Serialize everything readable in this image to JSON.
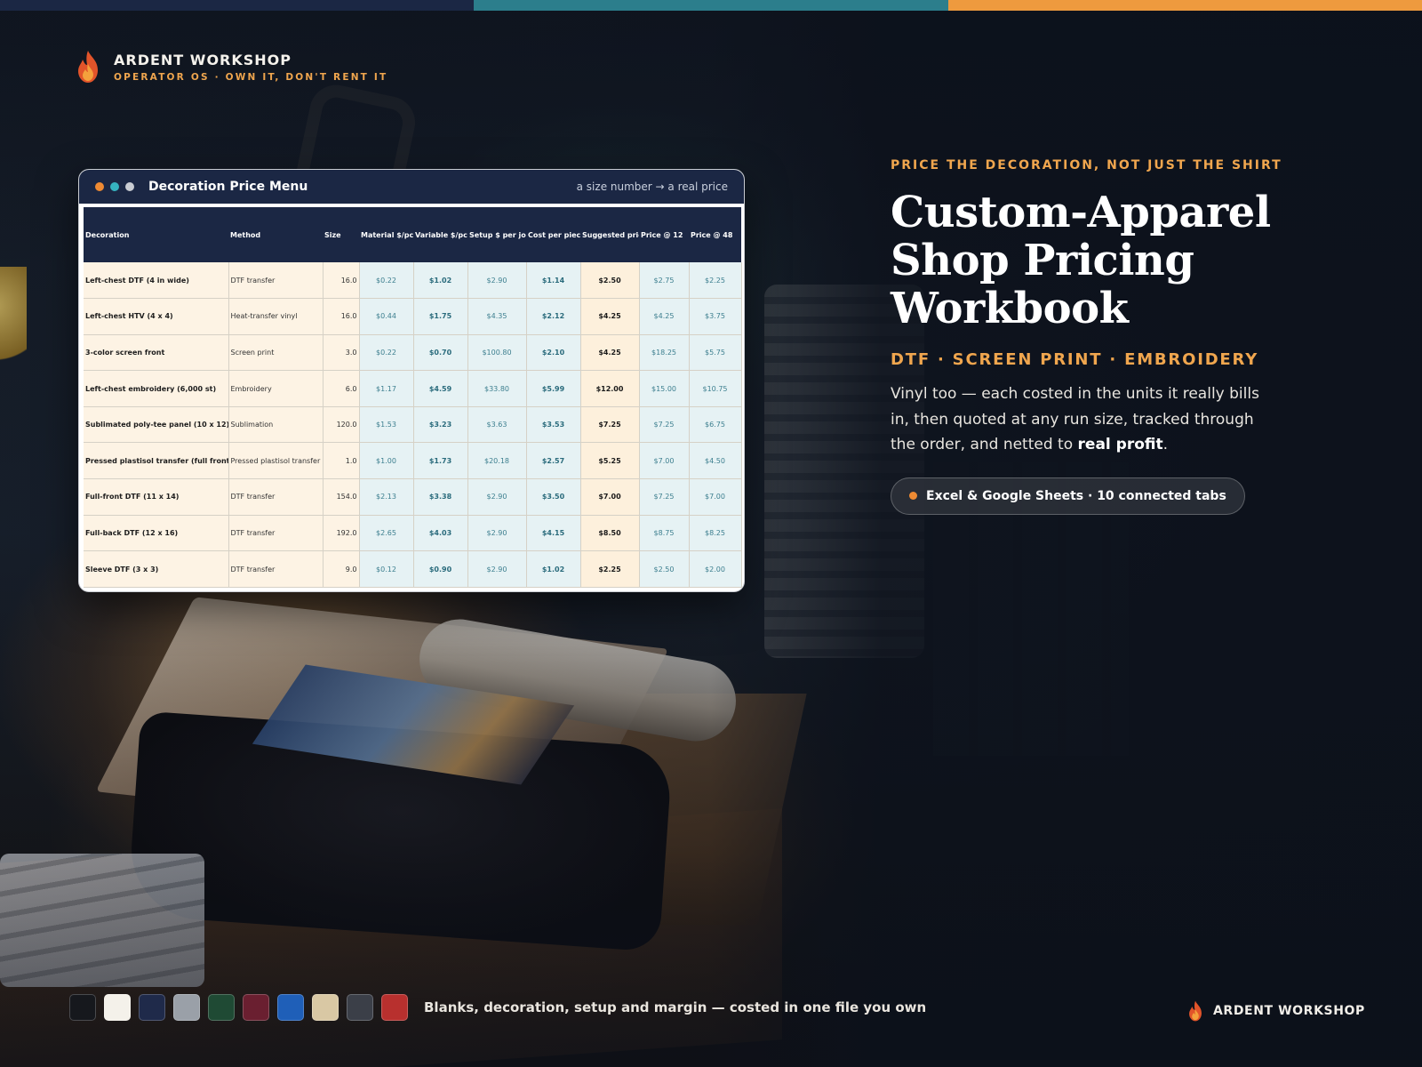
{
  "stripe_colors": [
    "#1b2744",
    "#2c7e8c",
    "#ee9a3e"
  ],
  "brand": {
    "name": "ARDENT WORKSHOP",
    "tagline": "OPERATOR OS · OWN IT, DON'T RENT IT",
    "logo_icon": "flame-icon"
  },
  "window": {
    "title": "Decoration Price Menu",
    "subtitle": "a size number → a real price",
    "dot_colors": [
      "#ee8a33",
      "#36b3c0",
      "#c9ccd2"
    ],
    "columns": [
      "Decoration",
      "Method",
      "Size",
      "Material $/pc",
      "Variable $/pc",
      "Setup $ per job",
      "Cost per piece",
      "Suggested price",
      "Price @ 12",
      "Price @ 48"
    ],
    "rows": [
      [
        "Left-chest DTF (4 in wide)",
        "DTF transfer",
        "16.0",
        "$0.22",
        "$1.02",
        "$2.90",
        "$1.14",
        "$2.50",
        "$2.75",
        "$2.25"
      ],
      [
        "Left-chest HTV (4 x 4)",
        "Heat-transfer vinyl",
        "16.0",
        "$0.44",
        "$1.75",
        "$4.35",
        "$2.12",
        "$4.25",
        "$4.25",
        "$3.75"
      ],
      [
        "3-color screen front",
        "Screen print",
        "3.0",
        "$0.22",
        "$0.70",
        "$100.80",
        "$2.10",
        "$4.25",
        "$18.25",
        "$5.75"
      ],
      [
        "Left-chest embroidery (6,000 st)",
        "Embroidery",
        "6.0",
        "$1.17",
        "$4.59",
        "$33.80",
        "$5.99",
        "$12.00",
        "$15.00",
        "$10.75"
      ],
      [
        "Sublimated poly-tee panel (10 x 12)",
        "Sublimation",
        "120.0",
        "$1.53",
        "$3.23",
        "$3.63",
        "$3.53",
        "$7.25",
        "$7.25",
        "$6.75"
      ],
      [
        "Pressed plastisol transfer (full front)",
        "Pressed plastisol transfer",
        "1.0",
        "$1.00",
        "$1.73",
        "$20.18",
        "$2.57",
        "$5.25",
        "$7.00",
        "$4.50"
      ],
      [
        "Full-front DTF (11 x 14)",
        "DTF transfer",
        "154.0",
        "$2.13",
        "$3.38",
        "$2.90",
        "$3.50",
        "$7.00",
        "$7.25",
        "$7.00"
      ],
      [
        "Full-back DTF (12 x 16)",
        "DTF transfer",
        "192.0",
        "$2.65",
        "$4.03",
        "$2.90",
        "$4.15",
        "$8.50",
        "$8.75",
        "$8.25"
      ],
      [
        "Sleeve DTF (3 x 3)",
        "DTF transfer",
        "9.0",
        "$0.12",
        "$0.90",
        "$2.90",
        "$1.02",
        "$2.25",
        "$2.50",
        "$2.00"
      ]
    ]
  },
  "hero": {
    "eyebrow": "PRICE THE DECORATION, NOT JUST THE SHIRT",
    "headline_lines": [
      "Custom-Apparel",
      "Shop Pricing",
      "Workbook"
    ],
    "subhead": "DTF · SCREEN PRINT · EMBROIDERY",
    "body_plain": "Vinyl too — each costed in the units it really bills in, then quoted at any run size, tracked through the order, and netted to ",
    "body_bold": "real profit",
    "body_end": ".",
    "pill_label": "Excel & Google Sheets · 10 connected tabs"
  },
  "footer": {
    "swatch_colors": [
      "#16181d",
      "#f4f1ea",
      "#1f2a4a",
      "#9aa0a8",
      "#1f4a34",
      "#6a1f30",
      "#1f5fb8",
      "#d9c8a4",
      "#3b3f48",
      "#b8302e"
    ],
    "tagline": "Blanks, decoration, setup and margin — costed in one file you own",
    "brand_name": "ARDENT WORKSHOP"
  },
  "colors": {
    "accent_orange": "#f0a64e",
    "navy": "#1b2744",
    "teal": "#2c7e8c"
  }
}
